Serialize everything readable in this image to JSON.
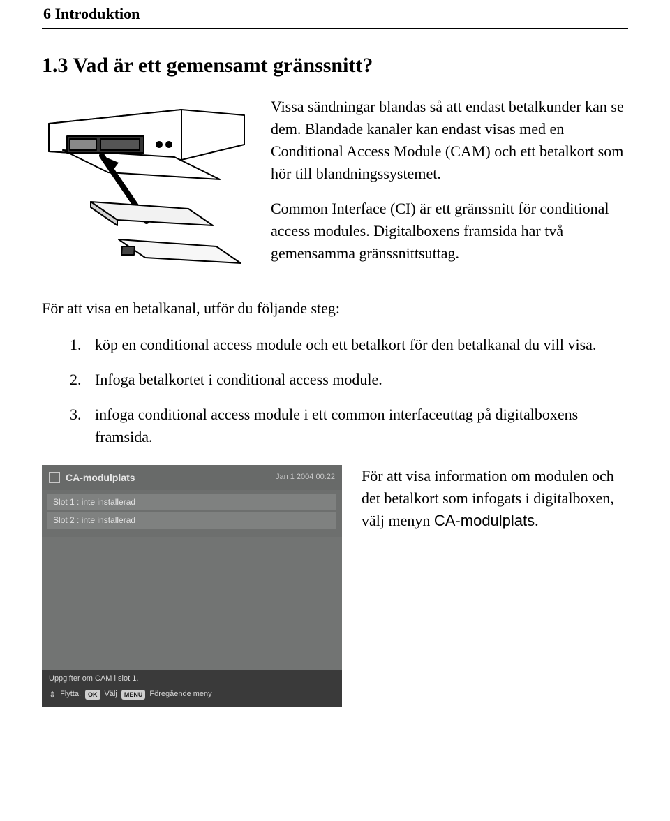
{
  "page": {
    "header": "6   Introduktion",
    "section_title": "1.3   Vad är ett gemensamt gränssnitt?"
  },
  "intro": {
    "p1": "Vissa sändningar blandas så att endast betalkunder kan se dem. Blandade kanaler kan endast visas med en Conditional Access Module (CAM) och ett betalkort som hör till blandningssystemet.",
    "p2": "Common Interface (CI) är ett gränssnitt för conditional access modules. Digitalboxens framsida har två gemensamma gränssnittsuttag."
  },
  "steps_lead": "För att visa en betalkanal, utför du följande steg:",
  "steps": [
    "köp en conditional access module och ett betalkort för den betalkanal du vill visa.",
    "Infoga betalkortet i conditional access module.",
    "infoga conditional access module i ett common interfaceuttag på digitalboxens framsida."
  ],
  "info": {
    "text_before": "För att visa information om modulen och det betalkort som infogats i digitalboxen, välj menyn ",
    "menu_name": "CA-modulplats",
    "text_after": "."
  },
  "ui": {
    "title": "CA-modulplats",
    "date": "Jan 1 2004 00:22",
    "slots": [
      "Slot 1 : inte installerad",
      "Slot 2 : inte installerad"
    ],
    "hint": "Uppgifter om CAM i slot 1.",
    "keys": {
      "move": "Flytta.",
      "ok": "OK",
      "select": "Välj",
      "menu": "MENU",
      "back": "Föregående meny"
    }
  }
}
